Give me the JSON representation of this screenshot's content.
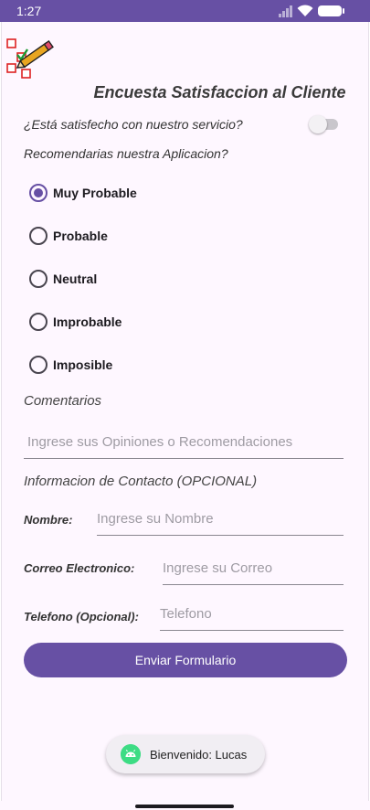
{
  "status_bar": {
    "time": "1:27"
  },
  "survey": {
    "title": "Encuesta Satisfaccion al Cliente",
    "satisfied_question": "¿Está satisfecho con nuestro servicio?",
    "satisfied_on": false,
    "recommend_question": "Recomendarias nuestra Aplicacion?",
    "options": [
      {
        "label": "Muy Probable",
        "checked": true
      },
      {
        "label": "Probable",
        "checked": false
      },
      {
        "label": "Neutral",
        "checked": false
      },
      {
        "label": "Improbable",
        "checked": false
      },
      {
        "label": "Imposible",
        "checked": false
      }
    ],
    "comments_label": "Comentarios",
    "comments_placeholder": "Ingrese sus Opiniones o Recomendaciones",
    "contact_label": "Informacion de Contacto (OPCIONAL)",
    "name_label": "Nombre:",
    "name_placeholder": "Ingrese su Nombre",
    "email_label": "Correo Electronico:",
    "email_placeholder": "Ingrese su Correo",
    "phone_label": "Telefono (Opcional):",
    "phone_placeholder": "Telefono",
    "submit_label": "Enviar Formulario"
  },
  "toast": {
    "text": "Bienvenido: Lucas"
  },
  "colors": {
    "primary": "#6750a4",
    "background": "#fef7ff",
    "toast_icon": "#3ddc84"
  }
}
